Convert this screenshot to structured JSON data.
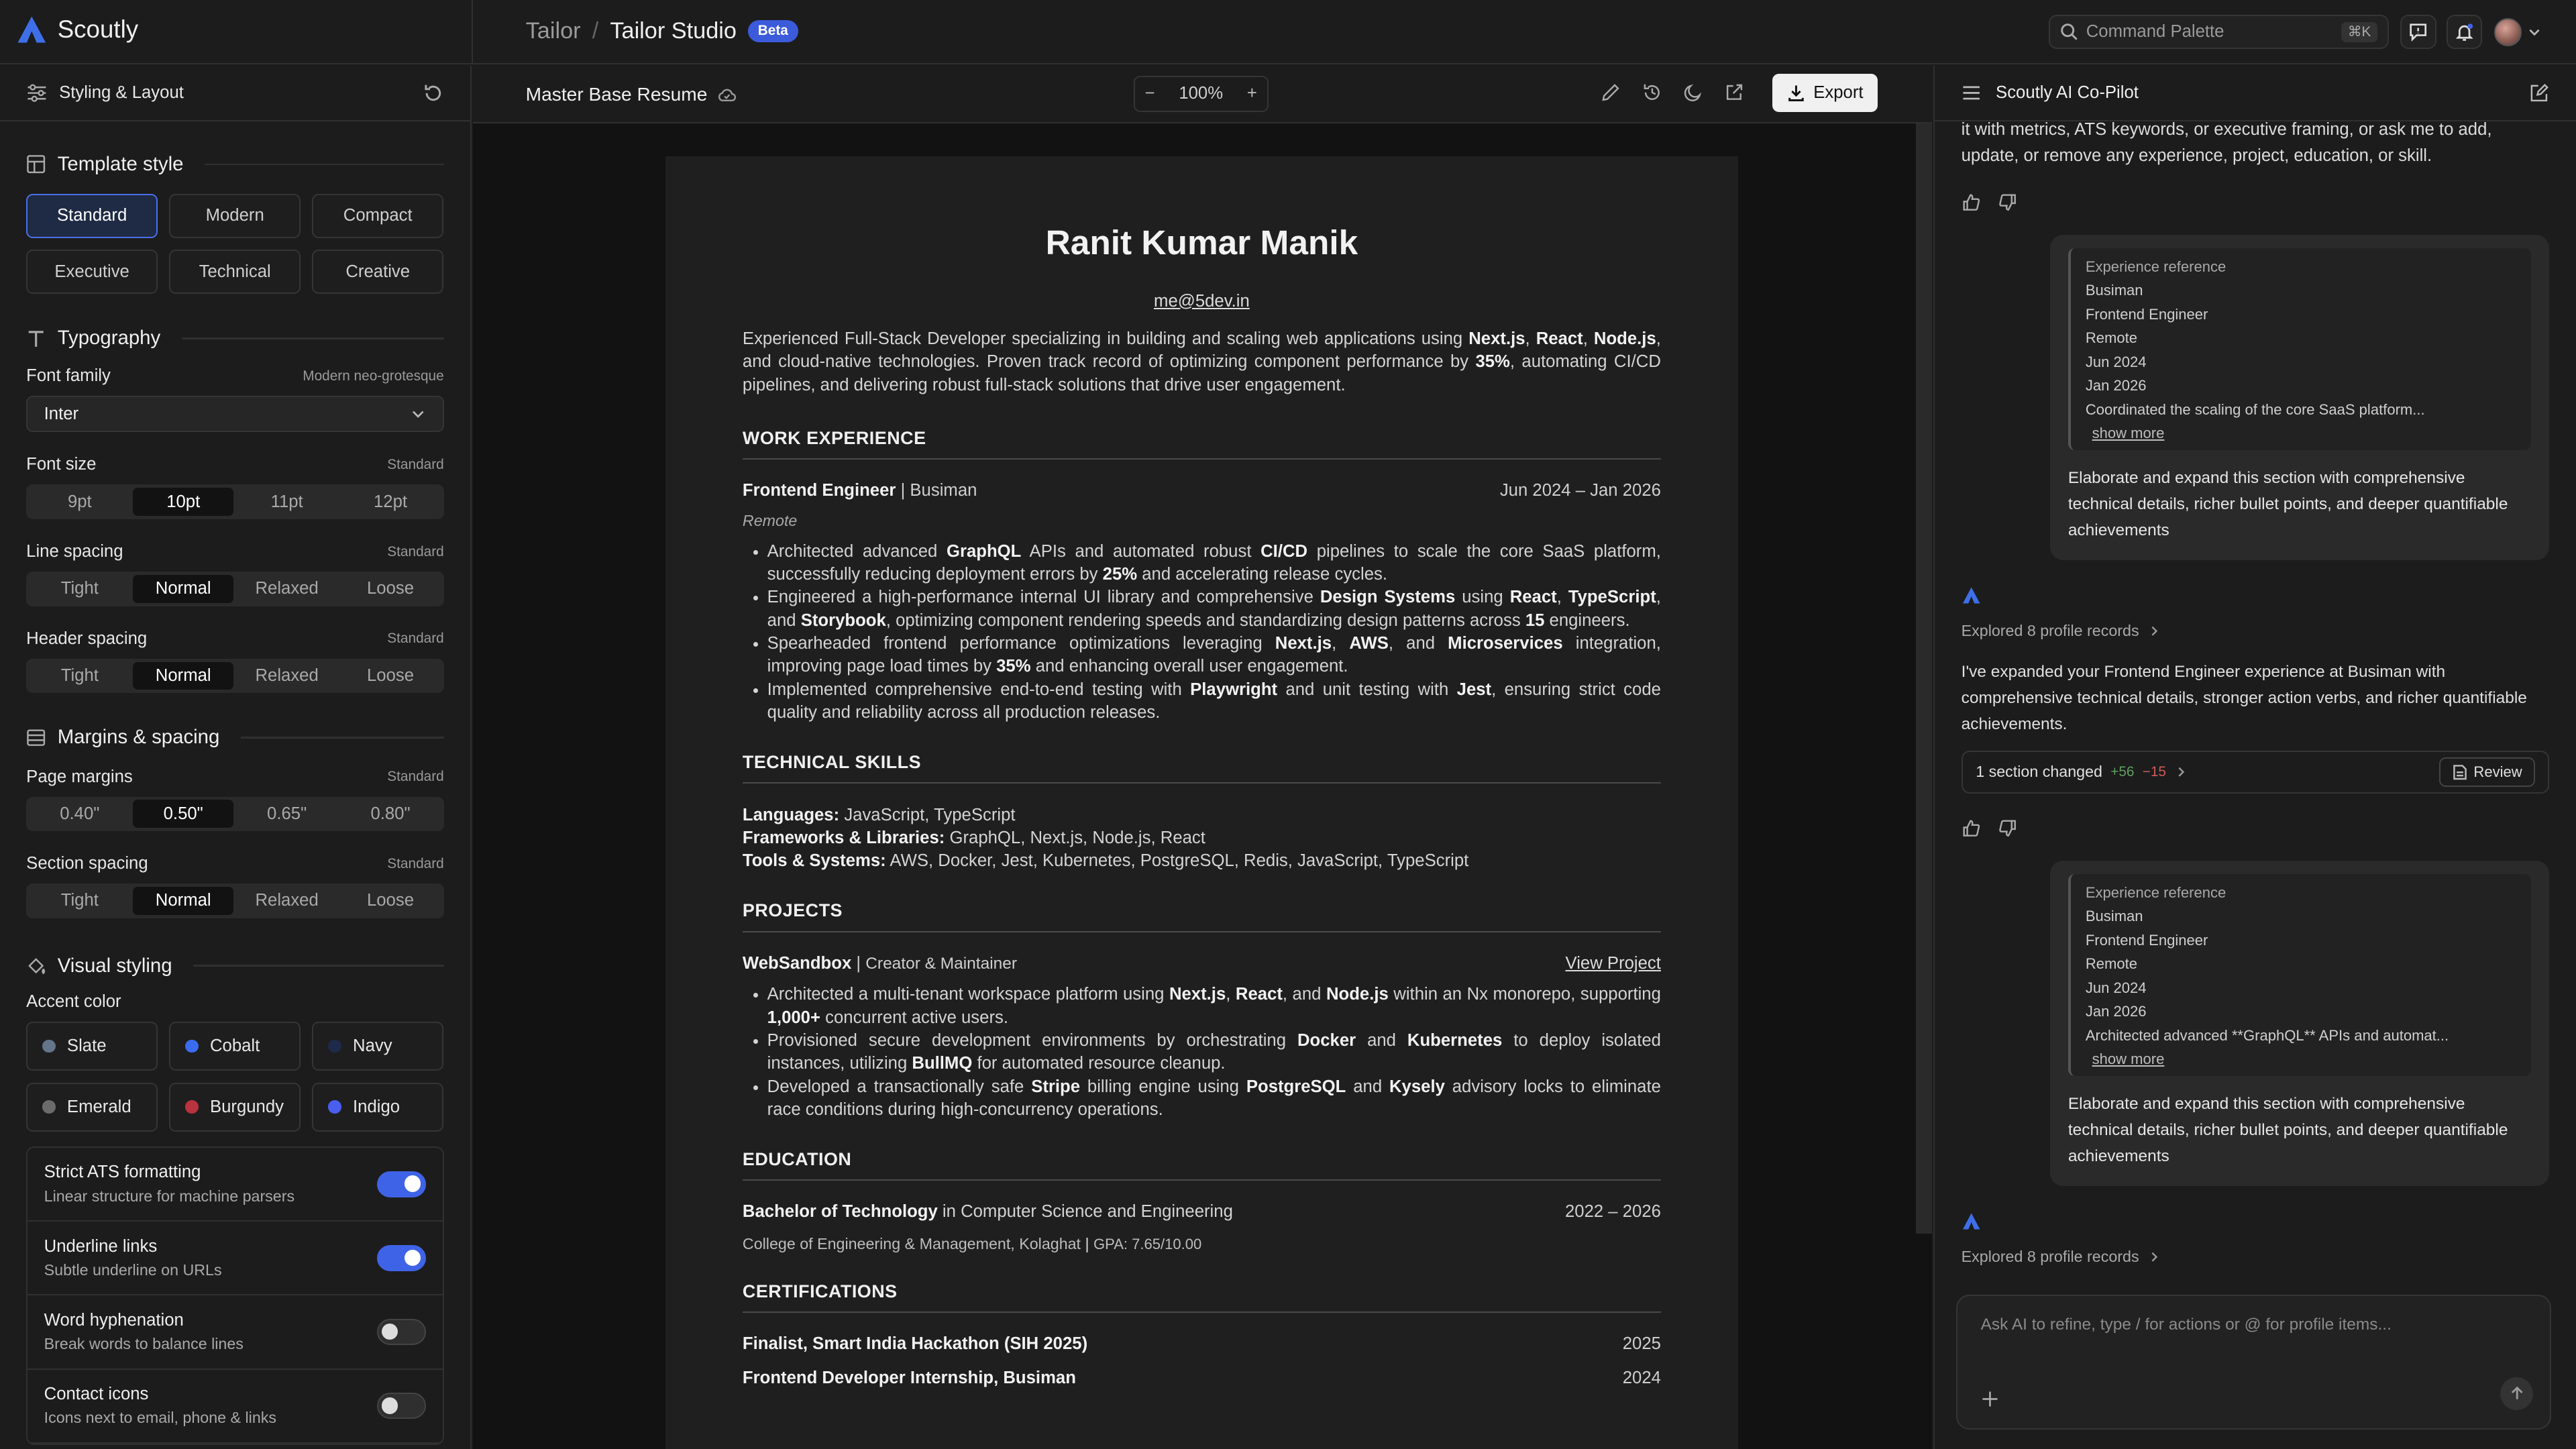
{
  "app": {
    "name": "Scoutly"
  },
  "breadcrumb": {
    "parent": "Tailor",
    "separator": "/",
    "current": "Tailor Studio",
    "badge": "Beta"
  },
  "command_palette": {
    "placeholder": "Command Palette",
    "shortcut": "⌘K"
  },
  "left_panel": {
    "title": "Styling & Layout",
    "template": {
      "heading": "Template style",
      "options": [
        "Standard",
        "Modern",
        "Compact",
        "Executive",
        "Technical",
        "Creative"
      ],
      "selected": "Standard"
    },
    "typography": {
      "heading": "Typography",
      "font_family": {
        "label": "Font family",
        "hint": "Modern neo-grotesque",
        "value": "Inter"
      },
      "font_size": {
        "label": "Font size",
        "hint": "Standard",
        "options": [
          "9pt",
          "10pt",
          "11pt",
          "12pt"
        ],
        "selected": "10pt"
      },
      "line_spacing": {
        "label": "Line spacing",
        "hint": "Standard",
        "options": [
          "Tight",
          "Normal",
          "Relaxed",
          "Loose"
        ],
        "selected": "Normal"
      },
      "header_spacing": {
        "label": "Header spacing",
        "hint": "Standard",
        "options": [
          "Tight",
          "Normal",
          "Relaxed",
          "Loose"
        ],
        "selected": "Normal"
      }
    },
    "margins": {
      "heading": "Margins & spacing",
      "page_margins": {
        "label": "Page margins",
        "hint": "Standard",
        "options": [
          "0.40\"",
          "0.50\"",
          "0.65\"",
          "0.80\""
        ],
        "selected": "0.50\""
      },
      "section_spacing": {
        "label": "Section spacing",
        "hint": "Standard",
        "options": [
          "Tight",
          "Normal",
          "Relaxed",
          "Loose"
        ],
        "selected": "Normal"
      }
    },
    "visual": {
      "heading": "Visual styling",
      "accent_label": "Accent color",
      "accents": [
        {
          "name": "Slate",
          "color": "#64748b"
        },
        {
          "name": "Cobalt",
          "color": "#3b6cf0"
        },
        {
          "name": "Navy",
          "color": "#1e2a4a"
        },
        {
          "name": "Emerald",
          "color": "#6b6b6b"
        },
        {
          "name": "Burgundy",
          "color": "#b8323f"
        },
        {
          "name": "Indigo",
          "color": "#4a5ef0"
        }
      ],
      "toggles": [
        {
          "title": "Strict ATS formatting",
          "sub": "Linear structure for machine parsers",
          "on": true
        },
        {
          "title": "Underline links",
          "sub": "Subtle underline on URLs",
          "on": true
        },
        {
          "title": "Word hyphenation",
          "sub": "Break words to balance lines",
          "on": false
        },
        {
          "title": "Contact icons",
          "sub": "Icons next to email, phone & links",
          "on": false
        }
      ]
    }
  },
  "center": {
    "doc_title": "Master Base Resume",
    "zoom": "100%",
    "export_label": "Export"
  },
  "resume": {
    "name": "Ranit Kumar Manik",
    "email": "me@5dev.in",
    "summary": [
      "Experienced Full-Stack Developer specializing in building and scaling web applications using ",
      "Next.js",
      ", ",
      "React",
      ", ",
      "Node.js",
      ", and cloud-native technologies. Proven track record of optimizing component performance by ",
      "35%",
      ", automating CI/CD pipelines, and delivering robust full-stack solutions that drive user engagement."
    ],
    "sections": {
      "work": "WORK EXPERIENCE",
      "skills": "TECHNICAL SKILLS",
      "projects": "PROJECTS",
      "education": "EDUCATION",
      "certs": "CERTIFICATIONS"
    },
    "job": {
      "role": "Frontend Engineer",
      "company": "Busiman",
      "dates": "Jun 2024 – Jan 2026",
      "location": "Remote",
      "bullets": [
        [
          "Architected advanced ",
          "GraphQL",
          " APIs and automated robust ",
          "CI/CD",
          " pipelines to scale the core SaaS platform, successfully reducing deployment errors by ",
          "25%",
          " and accelerating release cycles."
        ],
        [
          "Engineered a high-performance internal UI library and comprehensive ",
          "Design Systems",
          " using ",
          "React",
          ", ",
          "TypeScript",
          ", and ",
          "Storybook",
          ", optimizing component rendering speeds and standardizing design patterns across ",
          "15",
          " engineers."
        ],
        [
          "Spearheaded frontend performance optimizations leveraging ",
          "Next.js",
          ", ",
          "AWS",
          ", and ",
          "Microservices",
          " integration, improving page load times by ",
          "35%",
          " and enhancing overall user engagement."
        ],
        [
          "Implemented comprehensive end-to-end testing with ",
          "Playwright",
          " and unit testing with ",
          "Jest",
          ", ensuring strict code quality and reliability across all production releases."
        ]
      ]
    },
    "skills": [
      {
        "label": "Languages:",
        "value": "JavaScript, TypeScript"
      },
      {
        "label": "Frameworks & Libraries:",
        "value": "GraphQL, Next.js, Node.js, React"
      },
      {
        "label": "Tools & Systems:",
        "value": "AWS, Docker, Jest, Kubernetes, PostgreSQL, Redis, JavaScript, TypeScript"
      }
    ],
    "project": {
      "name": "WebSandbox",
      "role": "Creator & Maintainer",
      "link": "View Project",
      "bullets": [
        [
          "Architected a multi-tenant workspace platform using ",
          "Next.js",
          ", ",
          "React",
          ", and ",
          "Node.js",
          " within an Nx monorepo, supporting ",
          "1,000+",
          " concurrent active users."
        ],
        [
          "Provisioned secure development environments by orchestrating ",
          "Docker",
          " and ",
          "Kubernetes",
          " to deploy isolated instances, utilizing ",
          "BullMQ",
          " for automated resource cleanup."
        ],
        [
          "Developed a transactionally safe ",
          "Stripe",
          " billing engine using ",
          "PostgreSQL",
          " and ",
          "Kysely",
          " advisory locks to eliminate race conditions during high-concurrency operations."
        ]
      ]
    },
    "education": {
      "degree": "Bachelor of Technology",
      "field": " in Computer Science and Engineering",
      "dates": "2022 – 2026",
      "school": "College of Engineering & Management, Kolaghat",
      "gpa": "GPA: 7.65/10.00"
    },
    "certs": [
      {
        "name": "Finalist, Smart India Hackathon (SIH 2025)",
        "year": "2025"
      },
      {
        "name": "Frontend Developer Internship, Busiman",
        "year": "2024"
      }
    ]
  },
  "copilot": {
    "title": "Scoutly AI Co-Pilot",
    "intro_tail": "it with metrics, ATS keywords, or executive framing, or ask me to add, update, or remove any experience, project, education, or skill.",
    "user_msg_1": {
      "ref_heading": "Experience reference",
      "ref_lines": [
        "Busiman",
        "Frontend Engineer",
        "Remote",
        "Jun 2024",
        "Jan 2026",
        "Coordinated the scaling of the core SaaS platform..."
      ],
      "show_more": "show more",
      "text": "Elaborate and expand this section with comprehensive technical details, richer bullet points, and deeper quantifiable achievements"
    },
    "explored": "Explored 8 profile records",
    "reply": "I've expanded your Frontend Engineer experience at Busiman with comprehensive technical details, stronger action verbs, and richer quantifiable achievements.",
    "change": {
      "label": "1 section changed",
      "plus": "+56",
      "minus": "−15",
      "review": "Review"
    },
    "user_msg_2": {
      "ref_heading": "Experience reference",
      "ref_lines": [
        "Busiman",
        "Frontend Engineer",
        "Remote",
        "Jun 2024",
        "Jan 2026",
        "Architected advanced **GraphQL** APIs and automat..."
      ],
      "show_more": "show more",
      "text": "Elaborate and expand this section with comprehensive technical details, richer bullet points, and deeper quantifiable achievements"
    },
    "explored_2": "Explored 8 profile records",
    "input_placeholder": "Ask AI to refine, type / for actions or @ for profile items..."
  }
}
